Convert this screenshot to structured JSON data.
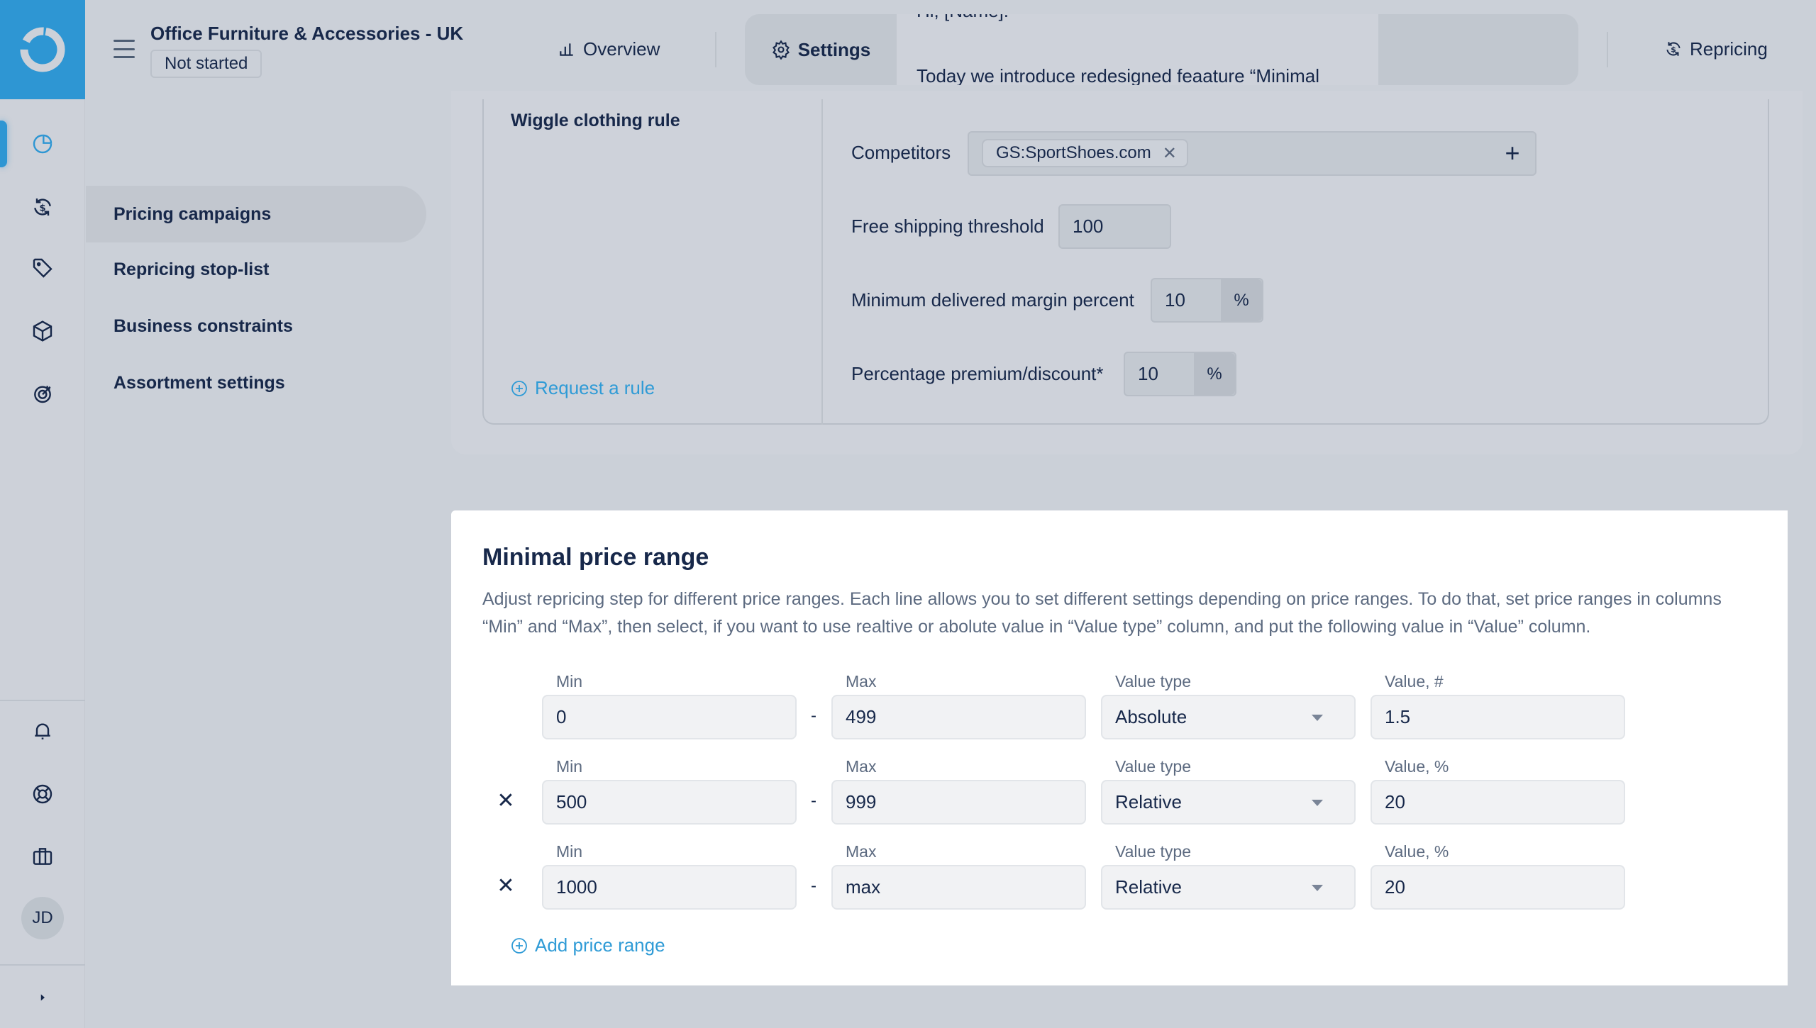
{
  "app": {
    "logo_icon": "donut-logo-icon",
    "brand_color": "#2e96d3",
    "link_color": "#2f9bd6"
  },
  "header": {
    "title": "Office Furniture & Accessories - UK",
    "status_badge": "Not started",
    "nav": {
      "overview": "Overview",
      "settings": "Settings",
      "repricing": "Repricing"
    },
    "announcement": {
      "greeting": "Hi, [Name].",
      "message": "Today we introduce redesigned feaature “Minimal"
    }
  },
  "rail": {
    "top_icons": [
      "pie-chart-icon",
      "dollar-cycle-icon",
      "tag-icon",
      "box-icon",
      "target-icon"
    ],
    "bottom_icons": [
      "bell-icon",
      "lifebuoy-icon",
      "briefcase-icon"
    ],
    "avatar_initials": "JD",
    "expand_icon": "caret-right-icon"
  },
  "submenu": {
    "items": [
      {
        "label": "Pricing campaigns",
        "active": true
      },
      {
        "label": "Repricing stop-list",
        "active": false
      },
      {
        "label": "Business constraints",
        "active": false
      },
      {
        "label": "Assortment settings",
        "active": false
      }
    ]
  },
  "rule_card": {
    "rule_name": "Wiggle clothing rule",
    "request_rule_label": "Request a rule",
    "fields": {
      "competitors": {
        "label": "Competitors",
        "chips": [
          "GS:SportShoes.com"
        ]
      },
      "free_shipping": {
        "label": "Free shipping threshold",
        "value": "100"
      },
      "min_margin": {
        "label": "Minimum delivered margin percent",
        "value": "10",
        "suffix": "%"
      },
      "premium_discount": {
        "label": "Percentage premium/discount*",
        "value": "10",
        "suffix": "%"
      }
    }
  },
  "price_range": {
    "title": "Minimal price range",
    "description": "Adjust repricing step for different price ranges. Each line allows you to set different settings depending on price ranges. To do that, set price ranges in columns “Min” and “Max”, then select, if you want to use realtive or abolute value in “Value type” column, and put the following value in “Value” column.",
    "labels": {
      "min": "Min",
      "max": "Max",
      "value_type": "Value type",
      "separator": "-"
    },
    "rows": [
      {
        "min": "0",
        "max": "499",
        "value_type": "Absolute",
        "value_label": "Value, #",
        "value": "1.5",
        "deletable": false
      },
      {
        "min": "500",
        "max": "999",
        "value_type": "Relative",
        "value_label": "Value, %",
        "value": "20",
        "deletable": true
      },
      {
        "min": "1000",
        "max": "max",
        "value_type": "Relative",
        "value_label": "Value, %",
        "value": "20",
        "deletable": true
      }
    ],
    "add_label": "Add price range"
  }
}
